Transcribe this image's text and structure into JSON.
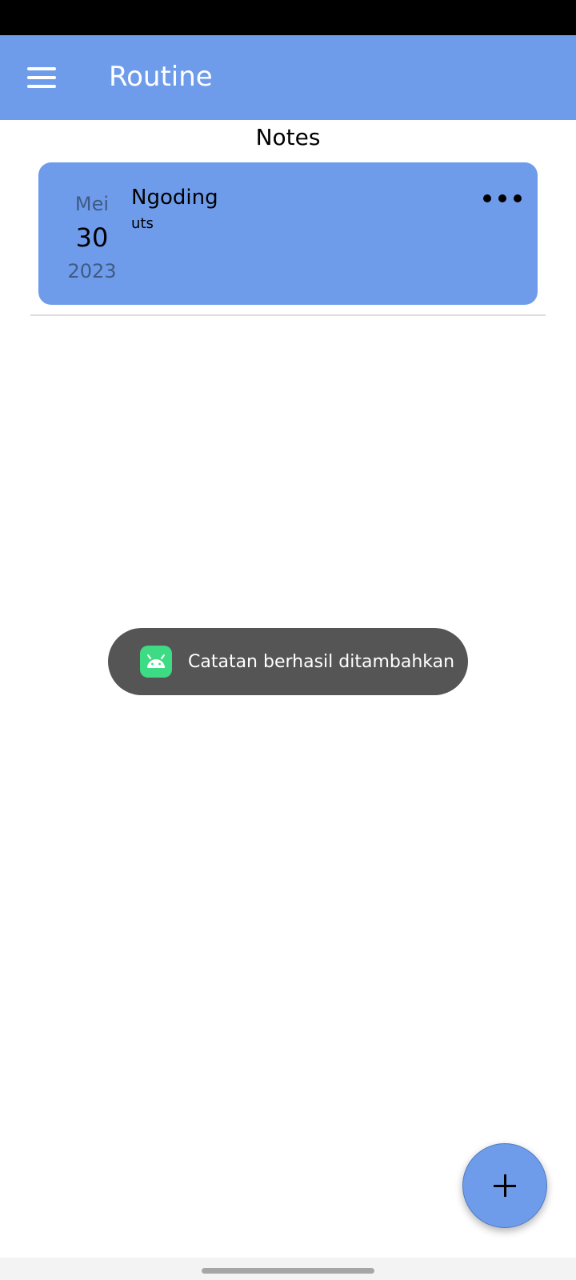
{
  "app_bar": {
    "title": "Routine",
    "menu_icon": "hamburger-menu-icon",
    "color": "#6e9ceb"
  },
  "section": {
    "title": "Notes"
  },
  "notes": [
    {
      "month": "Mei",
      "day": "30",
      "year": "2023",
      "title": "Ngoding",
      "body": "uts",
      "more_icon": "more-horizontal-icon"
    }
  ],
  "toast": {
    "icon": "android-icon",
    "message": "Catatan berhasil ditambahkan"
  },
  "fab": {
    "icon": "plus-icon"
  }
}
